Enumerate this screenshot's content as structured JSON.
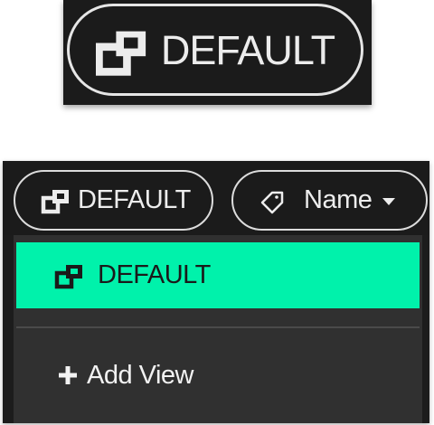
{
  "zoom_callout": {
    "icon": "views-icon",
    "label": "DEFAULT"
  },
  "toolbar": {
    "view_selector": {
      "icon": "views-icon",
      "label": "DEFAULT"
    },
    "sort_selector": {
      "icon": "tag-icon",
      "label": "Name",
      "caret": "caret-down-icon"
    }
  },
  "dropdown": {
    "selected_item": {
      "icon": "views-icon",
      "label": "DEFAULT"
    },
    "add_item": {
      "icon": "plus-icon",
      "label": "Add View"
    }
  },
  "colors": {
    "panel_bg": "#1b1b1b",
    "dropdown_bg": "#303030",
    "accent": "#00f2ab",
    "text_light": "#ececec",
    "text_dark": "#1a1a1a"
  }
}
